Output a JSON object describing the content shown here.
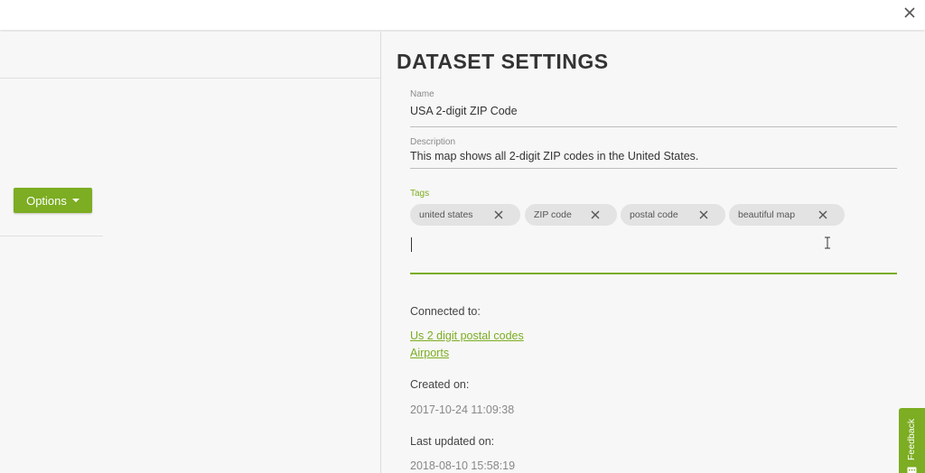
{
  "window": {
    "close_icon": "close-icon"
  },
  "left_pane": {
    "options_label": "Options"
  },
  "panel": {
    "title": "DATASET SETTINGS",
    "name": {
      "label": "Name",
      "value": "USA 2-digit ZIP Code"
    },
    "description": {
      "label": "Description",
      "value": "This map shows all 2-digit ZIP codes in the United States."
    },
    "tags": {
      "label": "Tags",
      "items": [
        "united states",
        "ZIP code",
        "postal code",
        "beautiful map"
      ]
    },
    "connected": {
      "label": "Connected to:",
      "links": [
        "Us 2 digit postal codes",
        "Airports"
      ]
    },
    "created": {
      "label": "Created on:",
      "value": "2017-10-24 11:09:38"
    },
    "updated": {
      "label": "Last updated on:",
      "value": "2018-08-10 15:58:19"
    }
  },
  "feedback": {
    "label": "Feedback"
  },
  "colors": {
    "accent": "#7cad22",
    "background": "#f7f7f7"
  }
}
